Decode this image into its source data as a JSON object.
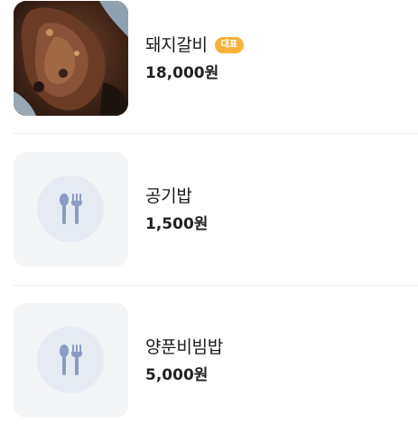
{
  "menu": {
    "items": [
      {
        "name": "돼지갈비",
        "badge": "대표",
        "price": "18,000원",
        "image": "pork-ribs-photo"
      },
      {
        "name": "공기밥",
        "price": "1,500원",
        "image": "utensils-placeholder-icon"
      },
      {
        "name": "양푼비빔밥",
        "price": "5,000원",
        "image": "utensils-placeholder-icon"
      }
    ]
  },
  "colors": {
    "badge": "#f7b23b",
    "placeholder_bg": "#f4f5f7",
    "icon_circle": "#e6ebf3",
    "icon": "#8a9bc4"
  }
}
